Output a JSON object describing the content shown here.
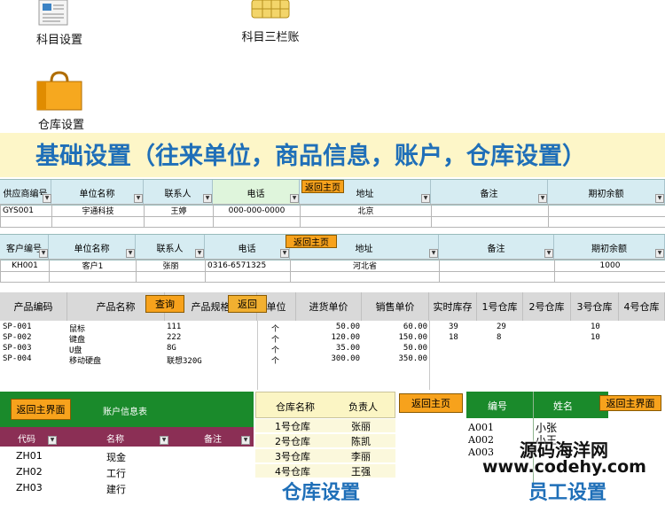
{
  "icons": [
    {
      "label": "科目设置"
    },
    {
      "label": "科目三栏账"
    },
    {
      "label": "仓库设置"
    }
  ],
  "banner": {
    "title": "基础设置（往来单位，商品信息，账户，仓库设置）"
  },
  "return_home": "返回主页",
  "return_main": "返回主界面",
  "query": "查询",
  "return": "返回",
  "supplier": {
    "headers": [
      "供应商编号",
      "单位名称",
      "联系人",
      "电话",
      "地址",
      "备注",
      "期初余额"
    ],
    "row": [
      "GYS001",
      "宇通科技",
      "王婷",
      "000-000-0000",
      "北京",
      "",
      ""
    ]
  },
  "customer": {
    "headers": [
      "客户编号",
      "单位名称",
      "联系人",
      "电话",
      "地址",
      "备注",
      "期初余额"
    ],
    "row": [
      "KH001",
      "客户1",
      "张丽",
      "0316-6571325",
      "河北省",
      "",
      "1000"
    ]
  },
  "product": {
    "headers": [
      "产品编码",
      "产品名称",
      "产品规格",
      "单位",
      "进货单价",
      "销售单价",
      "实时库存",
      "1号仓库",
      "2号仓库",
      "3号仓库",
      "4号仓库"
    ],
    "rows": [
      [
        "SP-001",
        "鼠标",
        "111",
        "个",
        "50.00",
        "60.00",
        "39",
        "29",
        "",
        "10",
        ""
      ],
      [
        "SP-002",
        "键盘",
        "222",
        "个",
        "120.00",
        "150.00",
        "18",
        "8",
        "",
        "10",
        ""
      ],
      [
        "SP-003",
        "U盘",
        "8G",
        "个",
        "35.00",
        "50.00",
        "",
        "",
        "",
        "",
        ""
      ],
      [
        "SP-004",
        "移动硬盘",
        "联想320G",
        "个",
        "300.00",
        "350.00",
        "",
        "",
        "",
        "",
        ""
      ]
    ]
  },
  "account": {
    "title": "账户信息表",
    "headers": [
      "代码",
      "名称",
      "备注"
    ],
    "rows": [
      [
        "ZH01",
        "现金",
        ""
      ],
      [
        "ZH02",
        "工行",
        ""
      ],
      [
        "ZH03",
        "建行",
        ""
      ]
    ]
  },
  "warehouse": {
    "headers": [
      "仓库名称",
      "负责人"
    ],
    "rows": [
      [
        "1号仓库",
        "张丽"
      ],
      [
        "2号仓库",
        "陈凯"
      ],
      [
        "3号仓库",
        "李丽"
      ],
      [
        "4号仓库",
        "王强"
      ]
    ],
    "footer": "仓库设置"
  },
  "staff": {
    "headers": [
      "编号",
      "姓名"
    ],
    "rows": [
      [
        "A001",
        "小张"
      ],
      [
        "A002",
        "小王"
      ],
      [
        "A003",
        ""
      ]
    ],
    "footer": "员工设置"
  },
  "watermark": {
    "line1": "源码海洋网",
    "line2": "www.codehy.com"
  },
  "colors": {
    "banner_text": "#1f6fb8",
    "banner_bg": "#fdf6c8",
    "header_blue": "#d6ecf2",
    "button_orange": "#f7a21c",
    "green": "#1a8a2b",
    "maroon": "#8b2f55"
  }
}
